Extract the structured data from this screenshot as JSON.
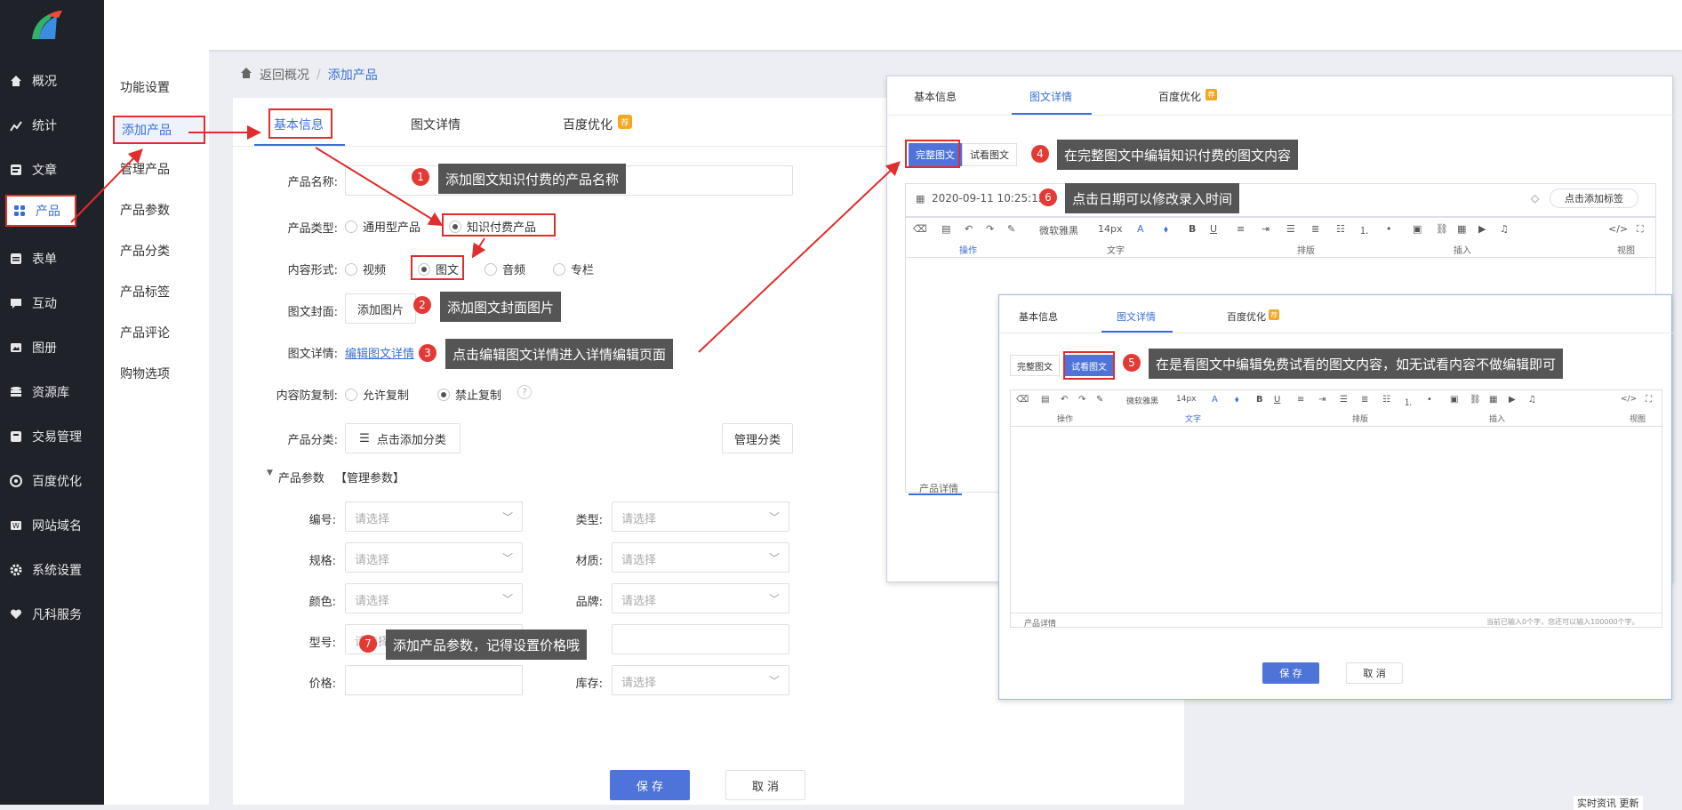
{
  "sidebar": {
    "items": [
      {
        "label": "概况",
        "icon": "home-icon"
      },
      {
        "label": "统计",
        "icon": "stats-icon"
      },
      {
        "label": "文章",
        "icon": "article-icon"
      },
      {
        "label": "产品",
        "icon": "grid-icon"
      },
      {
        "label": "表单",
        "icon": "form-icon"
      },
      {
        "label": "互动",
        "icon": "chat-icon"
      },
      {
        "label": "图册",
        "icon": "image-icon"
      },
      {
        "label": "资源库",
        "icon": "database-icon"
      },
      {
        "label": "交易管理",
        "icon": "trade-icon"
      },
      {
        "label": "百度优化",
        "icon": "target-icon"
      },
      {
        "label": "网站域名",
        "icon": "domain-icon"
      },
      {
        "label": "系统设置",
        "icon": "gear-icon"
      },
      {
        "label": "凡科服务",
        "icon": "heart-icon"
      }
    ]
  },
  "submenu": {
    "items": [
      "功能设置",
      "添加产品",
      "管理产品",
      "产品参数",
      "产品分类",
      "产品标签",
      "产品评论",
      "购物选项"
    ]
  },
  "breadcrumb": {
    "back": "返回概况",
    "sep": "/",
    "current": "添加产品"
  },
  "tabs": [
    "基本信息",
    "图文详情",
    "百度优化"
  ],
  "form": {
    "name_label": "产品名称:",
    "type_label": "产品类型:",
    "type_opt1": "通用型产品",
    "type_opt2": "知识付费产品",
    "content_label": "内容形式:",
    "content_opts": [
      "视频",
      "图文",
      "音频",
      "专栏"
    ],
    "cover_label": "图文封面:",
    "cover_btn": "添加图片",
    "detail_label": "图文详情:",
    "detail_link": "编辑图文详情",
    "copy_label": "内容防复制:",
    "copy_opt1": "允许复制",
    "copy_opt2": "禁止复制",
    "help": "?",
    "cat_label": "产品分类:",
    "cat_btn": "点击添加分类",
    "cat_manage": "管理分类",
    "params_title": "产品参数",
    "params_manage": "【管理参数】",
    "params": [
      {
        "label": "编号:",
        "placeholder": "请选择"
      },
      {
        "label": "类型:",
        "placeholder": "请选择"
      },
      {
        "label": "规格:",
        "placeholder": "请选择"
      },
      {
        "label": "材质:",
        "placeholder": "请选择"
      },
      {
        "label": "颜色:",
        "placeholder": "请选择"
      },
      {
        "label": "品牌:",
        "placeholder": "请选择"
      },
      {
        "label": "型号:",
        "placeholder": "请选择"
      },
      {
        "label": "价格:",
        "placeholder": ""
      },
      {
        "label": "库存:",
        "placeholder": "请选择"
      }
    ],
    "save": "保 存",
    "cancel": "取 消"
  },
  "callouts": {
    "c1": "添加图文知识付费的产品名称",
    "c2": "添加图文封面图片",
    "c3": "点击编辑图文详情进入详情编辑页面",
    "c4": "在完整图文中编辑知识付费的图文内容",
    "c5": "在是看图文中编辑免费试看的图文内容，如无试看内容不做编辑即可",
    "c6": "点击日期可以修改录入时间",
    "c7": "添加产品参数，记得设置价格哦"
  },
  "panel1": {
    "tabs": [
      "基本信息",
      "图文详情",
      "百度优化"
    ],
    "btn_full": "完整图文",
    "btn_trial": "试看图文",
    "date": "2020-09-11 10:25:12",
    "tag_btn": "点击添加标签",
    "font": "微软雅黑",
    "size": "14px",
    "groups": [
      "操作",
      "文字",
      "排版",
      "插入",
      "视图"
    ],
    "footer_tab": "产品详情"
  },
  "panel2": {
    "tabs": [
      "基本信息",
      "图文详情",
      "百度优化"
    ],
    "btn_full": "完整图文",
    "btn_trial": "试看图文",
    "font": "微软雅黑",
    "size": "14px",
    "groups": [
      "操作",
      "文字",
      "排版",
      "插入",
      "视图"
    ],
    "footer_tab": "产品详情",
    "counter": "当前已输入0个字，您还可以输入100000个字。",
    "save": "保 存",
    "cancel": "取 消"
  },
  "badge_hot": "HOT",
  "corner_text": "实时资讯 更新"
}
